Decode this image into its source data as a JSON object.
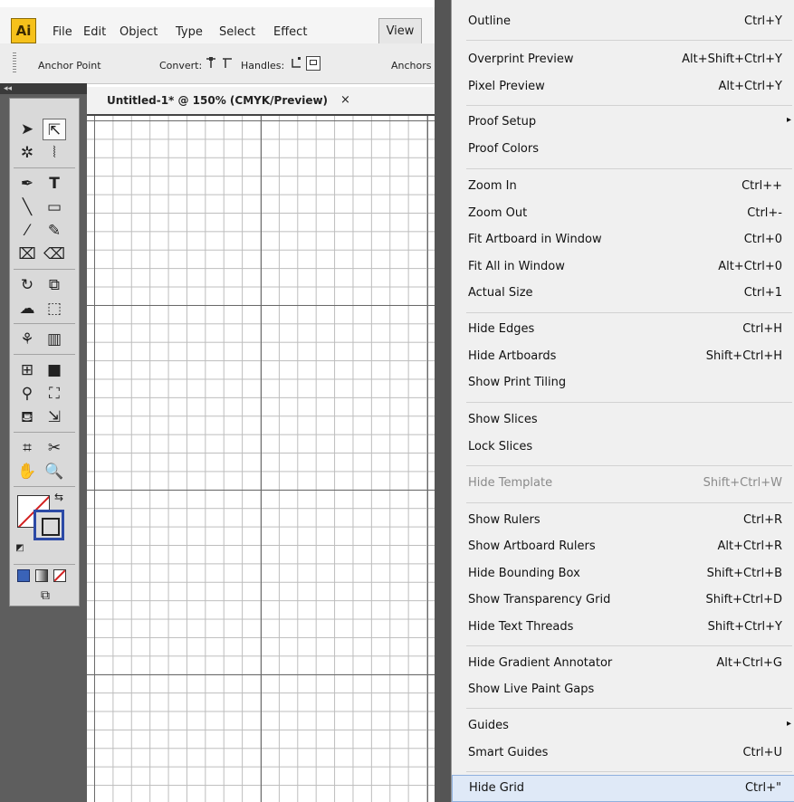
{
  "app": {
    "logo": "Ai",
    "menus": [
      {
        "label": "File"
      },
      {
        "label": "Edit"
      },
      {
        "label": "Object"
      },
      {
        "label": "Type"
      },
      {
        "label": "Select"
      },
      {
        "label": "Effect"
      },
      {
        "label": "View"
      }
    ]
  },
  "control_bar": {
    "anchor_point": "Anchor Point",
    "convert_label": "Convert:",
    "handles_label": "Handles:",
    "anchors_label": "Anchors"
  },
  "tools_panel": {
    "collapse": "◂◂",
    "tools": [
      "selection-icon",
      "direct-selection-icon",
      "magic-wand-icon",
      "lasso-icon",
      "pen-icon",
      "type-icon",
      "line-segment-icon",
      "rectangle-icon",
      "paintbrush-icon",
      "pencil-icon",
      "blob-brush-icon",
      "eraser-icon",
      "rotate-icon",
      "scale-icon",
      "warp-icon",
      "free-transform-icon",
      "symbol-sprayer-icon",
      "column-graph-icon",
      "mesh-icon",
      "gradient-icon",
      "eyedropper-icon",
      "blend-icon",
      "live-paint-bucket-icon",
      "live-paint-selection-icon",
      "artboard-icon",
      "slice-icon",
      "hand-icon",
      "zoom-icon"
    ],
    "fill_color": "#ffffff",
    "stroke_color": "#2c4aa6"
  },
  "document": {
    "tab_title": "Untitled-1* @ 150% (CMYK/Preview)",
    "close_glyph": "×"
  },
  "view_menu": {
    "items": [
      {
        "label": "Outline",
        "shortcut": "Ctrl+Y"
      },
      {
        "label": "Overprint Preview",
        "shortcut": "Alt+Shift+Ctrl+Y"
      },
      {
        "label": "Pixel Preview",
        "shortcut": "Alt+Ctrl+Y"
      },
      {
        "label": "Proof Setup",
        "shortcut": "",
        "submenu": "▸"
      },
      {
        "label": "Proof Colors",
        "shortcut": ""
      },
      {
        "label": "Zoom In",
        "shortcut": "Ctrl++"
      },
      {
        "label": "Zoom Out",
        "shortcut": "Ctrl+-"
      },
      {
        "label": "Fit Artboard in Window",
        "shortcut": "Ctrl+0"
      },
      {
        "label": "Fit All in Window",
        "shortcut": "Alt+Ctrl+0"
      },
      {
        "label": "Actual Size",
        "shortcut": "Ctrl+1"
      },
      {
        "label": "Hide Edges",
        "shortcut": "Ctrl+H"
      },
      {
        "label": "Hide Artboards",
        "shortcut": "Shift+Ctrl+H"
      },
      {
        "label": "Show Print Tiling",
        "shortcut": ""
      },
      {
        "label": "Show Slices",
        "shortcut": ""
      },
      {
        "label": "Lock Slices",
        "shortcut": ""
      },
      {
        "label": "Hide Template",
        "shortcut": "Shift+Ctrl+W",
        "disabled": true
      },
      {
        "label": "Show Rulers",
        "shortcut": "Ctrl+R"
      },
      {
        "label": "Show Artboard Rulers",
        "shortcut": "Alt+Ctrl+R"
      },
      {
        "label": "Hide Bounding Box",
        "shortcut": "Shift+Ctrl+B"
      },
      {
        "label": "Show Transparency Grid",
        "shortcut": "Shift+Ctrl+D"
      },
      {
        "label": "Hide Text Threads",
        "shortcut": "Shift+Ctrl+Y"
      },
      {
        "label": "Hide Gradient Annotator",
        "shortcut": "Alt+Ctrl+G"
      },
      {
        "label": "Show Live Paint Gaps",
        "shortcut": ""
      },
      {
        "label": "Guides",
        "shortcut": "",
        "submenu": "▸"
      },
      {
        "label": "Smart Guides",
        "shortcut": "Ctrl+U"
      },
      {
        "label": "Hide Grid",
        "shortcut": "Ctrl+\"",
        "highlighted": true
      }
    ]
  }
}
